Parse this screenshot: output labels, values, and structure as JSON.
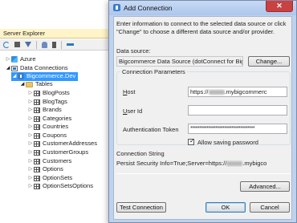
{
  "server_explorer": {
    "title": "Server Explorer",
    "toolbar_icons": [
      "refresh-icon",
      "stop-icon",
      "filter-icon",
      "connect-database-icon",
      "connect-server-icon",
      "connect-azure-icon"
    ],
    "tree": [
      {
        "label": "Azure",
        "icon": "azure-icon",
        "expanded": false
      },
      {
        "label": "Data Connections",
        "icon": "data-connections-icon",
        "expanded": true
      },
      {
        "label": "Bigcommerce.Dev",
        "icon": "database-connection-icon",
        "expanded": true,
        "selected": true
      },
      {
        "label": "Tables",
        "icon": "folder-icon",
        "expanded": true
      },
      {
        "label": "BlogPosts",
        "icon": "table-icon"
      },
      {
        "label": "BlogTags",
        "icon": "table-icon"
      },
      {
        "label": "Brands",
        "icon": "table-icon"
      },
      {
        "label": "Categories",
        "icon": "table-icon"
      },
      {
        "label": "Countries",
        "icon": "table-icon"
      },
      {
        "label": "Coupons",
        "icon": "table-icon"
      },
      {
        "label": "CustomerAddresses",
        "icon": "table-icon"
      },
      {
        "label": "CustomerGroups",
        "icon": "table-icon"
      },
      {
        "label": "Customers",
        "icon": "table-icon"
      },
      {
        "label": "Options",
        "icon": "table-icon"
      },
      {
        "label": "OptionSets",
        "icon": "table-icon"
      },
      {
        "label": "OptionSetsOptions",
        "icon": "table-icon"
      }
    ]
  },
  "dialog": {
    "title": "Add Connection",
    "close_glyph": "✕",
    "intro": "Enter information to connect to the selected data source or click \"Change\" to choose a different data source and/or provider.",
    "data_source_label": "Data source:",
    "data_source_value": "Bigcommerce Data Source (dotConnect for Bigc",
    "change_button": "Change...",
    "connection_parameters_label": "Connection Parameters",
    "host_label": "Host",
    "host_value_prefix": "https://",
    "host_value_suffix": ".mybigcommerc",
    "user_id_label": "User Id",
    "auth_token_label": "Authentication Token",
    "auth_token_value": "************************************",
    "allow_saving_password_label": "Allow saving password",
    "allow_saving_password_checked": true,
    "connection_string_label": "Connection String",
    "connection_string_prefix": "Persist Security Info=True;Server=https://",
    "connection_string_suffix": ".mybigco",
    "advanced_button": "Advanced...",
    "test_connection_button": "Test Connection",
    "ok_button": "OK",
    "cancel_button": "Cancel"
  },
  "colors": {
    "selection": "#3399ff",
    "dialog_frame": "#bdd2ef",
    "close_button": "#c94141",
    "server_explorer_title": "#fff3c8"
  }
}
